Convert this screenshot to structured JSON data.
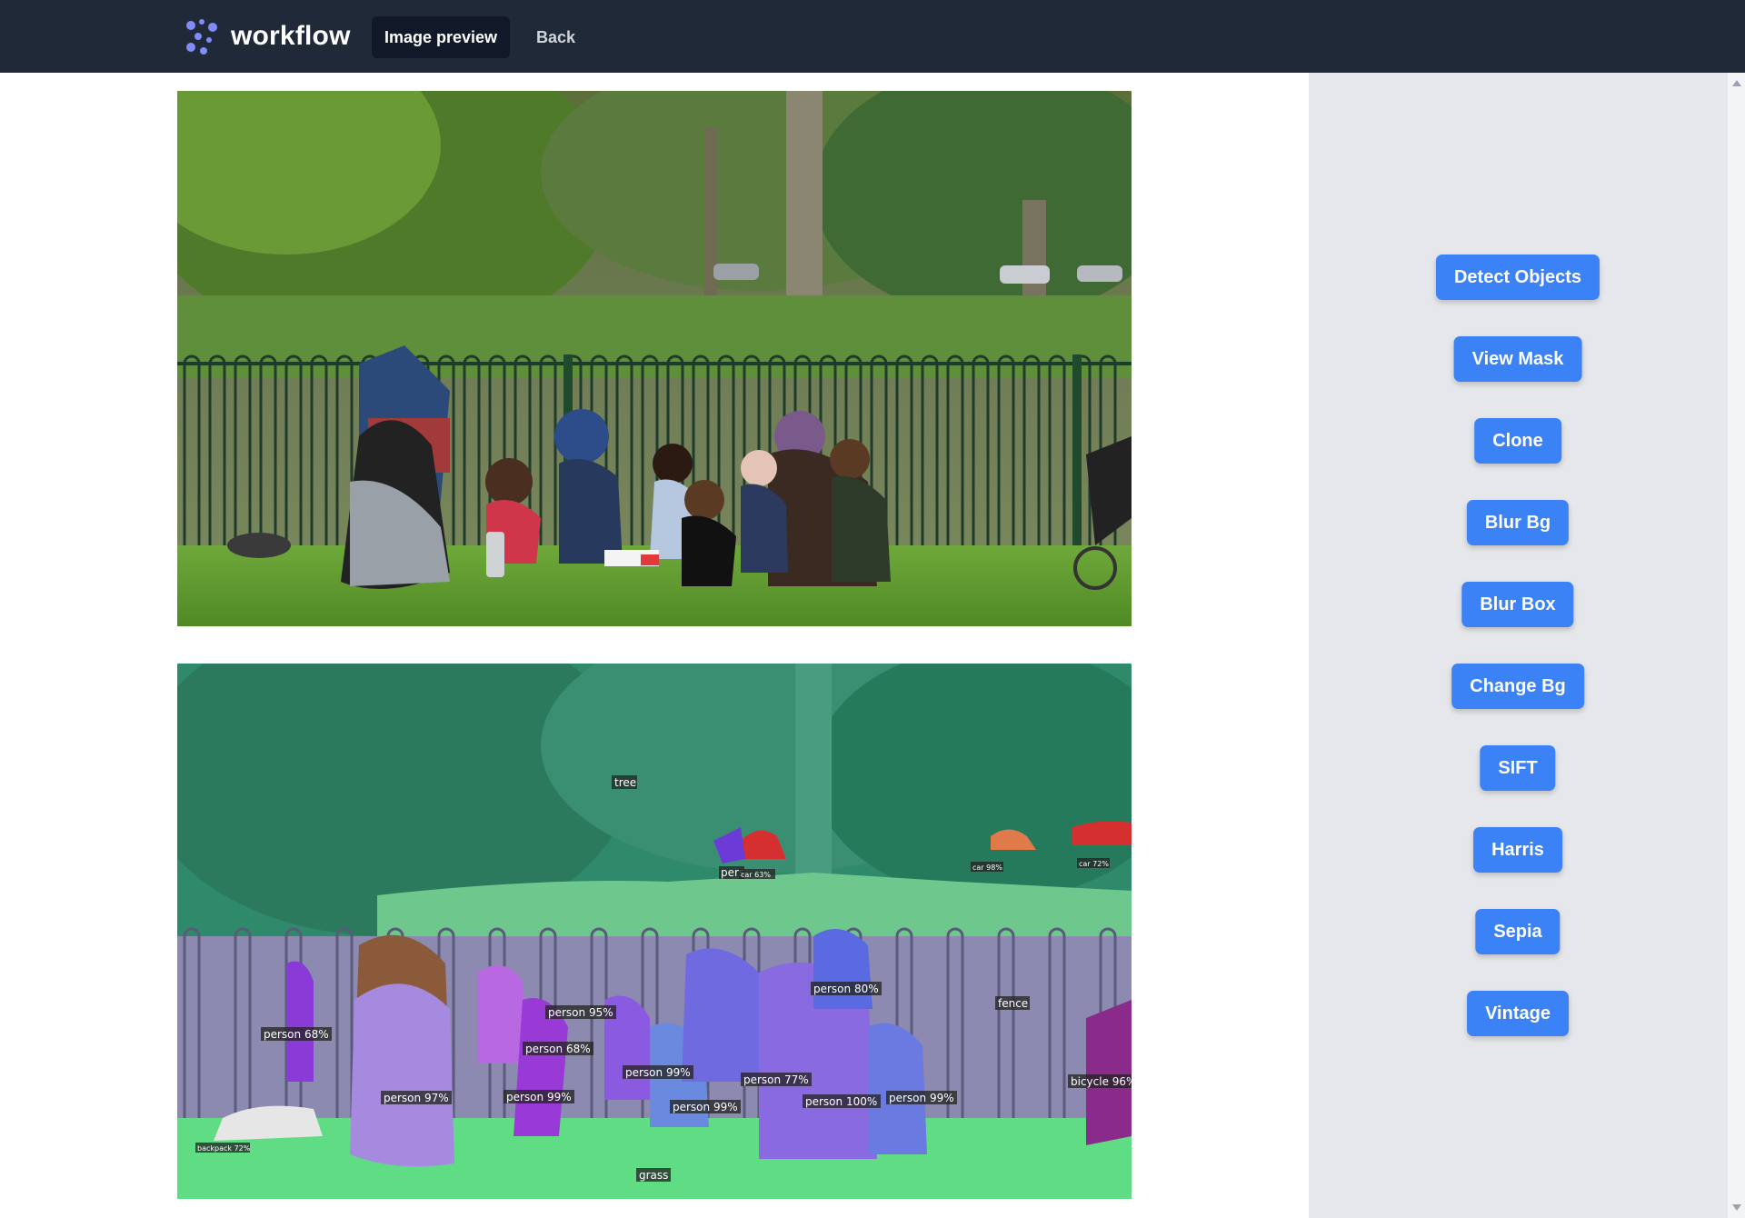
{
  "app": {
    "name": "workflow"
  },
  "nav": {
    "active_tab": "Image preview",
    "back_link": "Back"
  },
  "images": {
    "original_alt": "Original photo",
    "segmented_alt": "Segmented photo"
  },
  "detections": {
    "tree": "tree",
    "car_1": "car 98%",
    "car_2": "car 72%",
    "person_small": "pers",
    "car_small": "car 63%",
    "fence": "fence",
    "person_80": "person 80%",
    "person_95": "person 95%",
    "person_68a": "person 68%",
    "person_68b": "person 68%",
    "person_99a": "person 99%",
    "person_77": "person 77%",
    "person_97": "person 97%",
    "person_99b": "person 99%",
    "person_99c": "person 99%",
    "person_100": "person 100%",
    "person_99d": "person 99%",
    "bicycle": "bicycle 96%",
    "backpack": "backpack 72%",
    "grass": "grass"
  },
  "actions": [
    "Detect Objects",
    "View Mask",
    "Clone",
    "Blur Bg",
    "Blur Box",
    "Change Bg",
    "SIFT",
    "Harris",
    "Sepia",
    "Vintage"
  ],
  "colors": {
    "topbar": "#1f2937",
    "accent": "#3b82f6",
    "sidebar": "#e5e7eb",
    "brand_icon": "#818cf8"
  }
}
